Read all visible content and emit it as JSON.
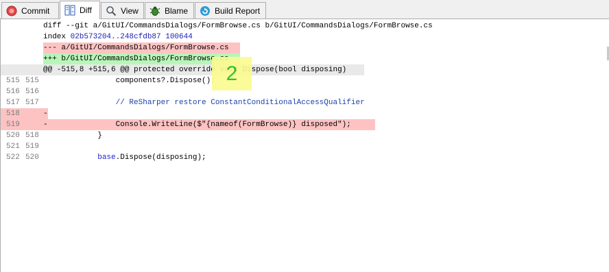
{
  "tabs": [
    {
      "label": "Commit",
      "icon": "commit-icon",
      "active": false
    },
    {
      "label": "Diff",
      "icon": "diff-icon",
      "active": true
    },
    {
      "label": "View",
      "icon": "view-icon",
      "active": false
    },
    {
      "label": "Blame",
      "icon": "blame-icon",
      "active": false
    },
    {
      "label": "Build Report",
      "icon": "build-report-icon",
      "active": false
    }
  ],
  "diff": {
    "header_git": "diff --git a/GitUI/CommandsDialogs/FormBrowse.cs b/GitUI/CommandsDialogs/FormBrowse.cs",
    "header_index_label": "index ",
    "header_index_hash": "02b573204..248cfdb87 100644",
    "header_minus": "--- a/GitUI/CommandsDialogs/FormBrowse.cs",
    "header_plus": "+++ b/GitUI/CommandsDialogs/FormBrowse.cs",
    "hunk": "@@ -515,8 +515,6 @@ protected override void Dispose(bool disposing)",
    "lines": [
      {
        "old": "515",
        "new": "515",
        "text": "                components?.Dispose();"
      },
      {
        "old": "516",
        "new": "516",
        "text": ""
      },
      {
        "old": "517",
        "new": "517",
        "text": "                // ReSharper restore ConstantConditionalAccessQualifier"
      },
      {
        "old": "518",
        "new": "",
        "text": "-"
      },
      {
        "old": "519",
        "new": "",
        "text": "-               Console.WriteLine($\"{nameof(FormBrowse)} disposed\");"
      },
      {
        "old": "520",
        "new": "518",
        "text": "            }"
      },
      {
        "old": "521",
        "new": "519",
        "text": ""
      },
      {
        "old": "522",
        "new": "520",
        "text": "            base.Dispose(disposing);"
      }
    ]
  },
  "badge": {
    "text": "2"
  },
  "colors": {
    "removed_bg": "#fdc3c3",
    "added_bg": "#b8f5b8",
    "hunk_bg": "#e9e9e9",
    "badge_bg": "#fbfb91",
    "badge_text": "#1fc11f"
  }
}
